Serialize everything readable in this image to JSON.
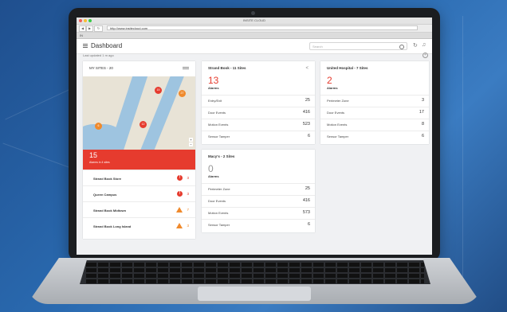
{
  "browser": {
    "window_title": "INSITE CLOUD",
    "url": "http://www.insitecloud.com",
    "tab_label": "IN"
  },
  "header": {
    "title": "Dashboard",
    "search_placeholder": "Search",
    "icons": [
      "menu-icon",
      "search-icon",
      "refresh-icon",
      "bell-icon"
    ]
  },
  "status": {
    "last_updated": "Last updated 1 m ago"
  },
  "my_sites": {
    "title": "MY SITES - 20",
    "alarm_total": "15",
    "alarm_total_label": "Alarms in 4 sites",
    "map_pins": [
      "15",
      "27",
      "6",
      "12"
    ],
    "sites": [
      {
        "name": "Strand Book Store",
        "count": "3",
        "icon": "alert-circle-icon",
        "color": "#e63b2e"
      },
      {
        "name": "Queen Campus",
        "count": "3",
        "icon": "alert-circle-icon",
        "color": "#e63b2e"
      },
      {
        "name": "Strand Book Midtown",
        "count": "7",
        "icon": "warning-triangle-icon",
        "color": "#f08a2c"
      },
      {
        "name": "Strand Book Long Island",
        "count": "3",
        "icon": "warning-triangle-icon",
        "color": "#f08a2c"
      }
    ]
  },
  "cards": [
    {
      "title": "Strand Book - 11 Sites",
      "alarms": "13",
      "alarms_label": "Alarms",
      "rows": [
        {
          "k": "Entry/Exit",
          "v": "25"
        },
        {
          "k": "Door Events",
          "v": "416"
        },
        {
          "k": "Motion Events",
          "v": "523"
        },
        {
          "k": "Sensor Tamper",
          "v": "6"
        }
      ]
    },
    {
      "title": "United Hospital - 7 Sites",
      "alarms": "2",
      "alarms_label": "Alarms",
      "rows": [
        {
          "k": "Perimeter Zone",
          "v": "3"
        },
        {
          "k": "Door Events",
          "v": "17"
        },
        {
          "k": "Motion Events",
          "v": "8"
        },
        {
          "k": "Sensor Tamper",
          "v": "6"
        }
      ]
    },
    {
      "title": "Macy's - 2 Sites",
      "alarms": "0",
      "alarms_label": "Alarms",
      "rows": [
        {
          "k": "Perimeter Zone",
          "v": "25"
        },
        {
          "k": "Door Events",
          "v": "416"
        },
        {
          "k": "Motion Events",
          "v": "573"
        },
        {
          "k": "Sensor Tamper",
          "v": "6"
        }
      ]
    }
  ],
  "colors": {
    "alarm_red": "#e63b2e",
    "warning_orange": "#f08a2c",
    "background_blue": "#2a6ab0"
  }
}
